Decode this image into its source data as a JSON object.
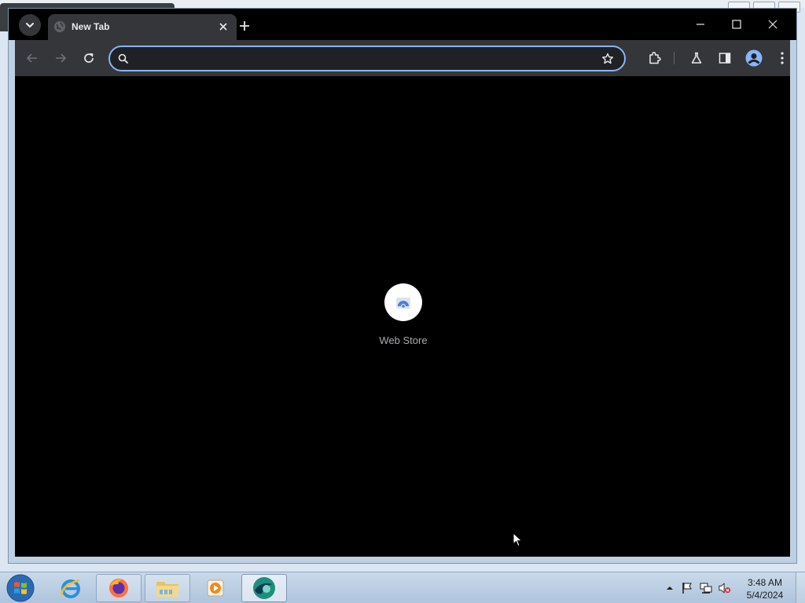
{
  "browser": {
    "tabs": [
      {
        "title": "New Tab",
        "active": true
      }
    ],
    "omnibox": {
      "value": "",
      "placeholder": ""
    },
    "shortcuts": [
      {
        "label": "Web Store",
        "icon": "web-store-icon"
      }
    ],
    "toolbar_icons": [
      "back-arrow-icon",
      "forward-arrow-icon",
      "reload-icon",
      "star-icon",
      "extensions-icon",
      "chrome-labs-icon",
      "side-panel-icon",
      "profile-icon",
      "more-menu-icon"
    ],
    "window_controls": [
      "minimize-icon",
      "maximize-icon",
      "close-icon"
    ]
  },
  "taskbar": {
    "pinned": [
      "internet-explorer-icon",
      "firefox-icon",
      "file-explorer-icon",
      "media-player-icon",
      "browser-app-icon"
    ],
    "clock": {
      "time": "3:48 AM",
      "date": "5/4/2024"
    },
    "tray_icons": [
      "show-hidden-icons",
      "action-center-flag-icon",
      "network-icon",
      "volume-muted-icon"
    ]
  },
  "colors": {
    "accent": "#8ab4f8",
    "toolbar": "#35363a",
    "content_bg": "#000000",
    "titlebar": "#000000"
  }
}
